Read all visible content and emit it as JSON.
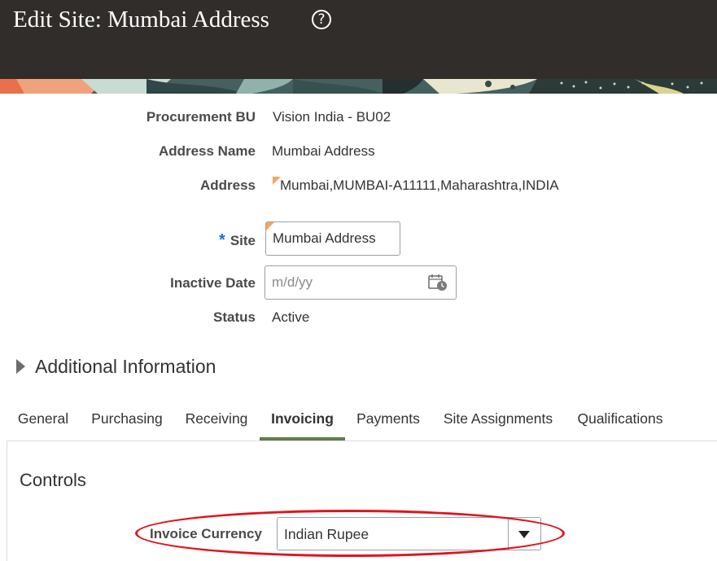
{
  "header": {
    "title": "Edit Site: Mumbai Address",
    "help_icon": "question-circle-icon",
    "help_glyph": "?"
  },
  "form": {
    "procurement_bu": {
      "label": "Procurement BU",
      "value": "Vision India - BU02"
    },
    "address_name": {
      "label": "Address Name",
      "value": "Mumbai Address"
    },
    "address": {
      "label": "Address",
      "value": "Mumbai,MUMBAI-A11111,Maharashtra,INDIA"
    },
    "site": {
      "required_marker": "*",
      "label": "Site",
      "value": "Mumbai Address"
    },
    "inactive_date": {
      "label": "Inactive Date",
      "value": "",
      "placeholder": "m/d/yy",
      "icon": "calendar-icon"
    },
    "status": {
      "label": "Status",
      "value": "Active"
    }
  },
  "additional_information": {
    "label": "Additional Information",
    "icon": "disclosure-triangle-icon",
    "expanded": false
  },
  "tabs": [
    {
      "label": "General",
      "active": false
    },
    {
      "label": "Purchasing",
      "active": false
    },
    {
      "label": "Receiving",
      "active": false
    },
    {
      "label": "Invoicing",
      "active": true
    },
    {
      "label": "Payments",
      "active": false
    },
    {
      "label": "Site Assignments",
      "active": false
    },
    {
      "label": "Qualifications",
      "active": false
    }
  ],
  "controls": {
    "heading": "Controls",
    "invoice_currency": {
      "label": "Invoice Currency",
      "value": "Indian Rupee",
      "icon": "dropdown-arrow-icon"
    }
  },
  "colors": {
    "header_bg": "#312d2a",
    "active_tab_underline": "#5f7c4a",
    "required_star": "#1a6fd1",
    "highlight": "#e0141e",
    "changed_indicator": "#f5a662"
  }
}
